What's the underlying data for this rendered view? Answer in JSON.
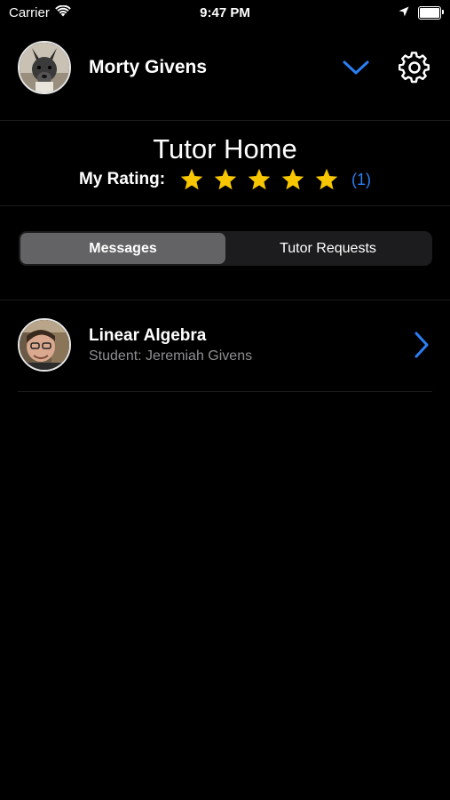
{
  "status_bar": {
    "carrier": "Carrier",
    "time": "9:47 PM",
    "icons": [
      "wifi-icon",
      "location-arrow-icon",
      "battery-icon"
    ]
  },
  "header": {
    "user_name": "Morty Givens",
    "avatar_icon": "dog-avatar",
    "dropdown_icon": "chevron-down-icon",
    "settings_icon": "gear-icon"
  },
  "main": {
    "title": "Tutor Home",
    "rating_label": "My Rating:",
    "rating_stars": 5,
    "rating_max": 5,
    "rating_count": "(1)"
  },
  "tabs": {
    "items": [
      {
        "label": "Messages",
        "selected": true
      },
      {
        "label": "Tutor Requests",
        "selected": false
      }
    ]
  },
  "messages": [
    {
      "title": "Linear Algebra",
      "subtitle": "Student: Jeremiah Givens",
      "avatar_icon": "student-avatar",
      "action_icon": "chevron-right-icon"
    }
  ],
  "colors": {
    "accent": "#2b7ff5",
    "star": "#f7c600",
    "background": "#000000",
    "segment_bg": "#1c1c1e",
    "segment_active": "#636366",
    "secondary_text": "#8e8e93"
  }
}
